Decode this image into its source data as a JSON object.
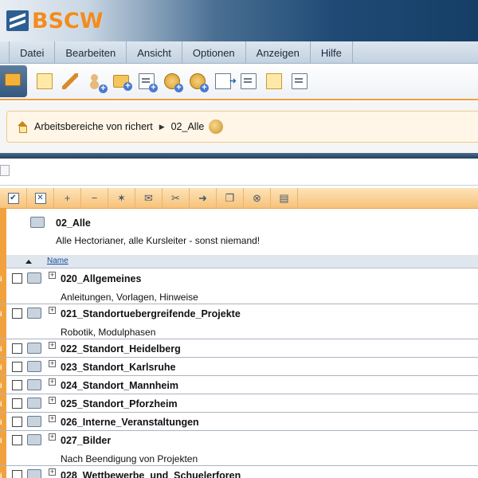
{
  "app": {
    "logo_text": "BSCW"
  },
  "menu": [
    "Datei",
    "Bearbeiten",
    "Ansicht",
    "Optionen",
    "Anzeigen",
    "Hilfe"
  ],
  "toolbar_icons": [
    "info-icon",
    "edit-icon",
    "add-member-icon",
    "new-folder-icon",
    "new-document-icon",
    "new-url-icon",
    "new-discussion-icon",
    "send-to-icon",
    "paste-icon",
    "mail-icon",
    "note-icon"
  ],
  "breadcrumb": {
    "items": [
      "Arbeitsbereiche von richert",
      "02_Alle"
    ]
  },
  "folder": {
    "title": "02_Alle",
    "description": "Alle Hectorianer, alle Kursleiter - sonst niemand!"
  },
  "table": {
    "column_name": "Name",
    "rows": [
      {
        "title": "020_Allgemeines",
        "description": "Anleitungen, Vorlagen, Hinweise"
      },
      {
        "title": "021_Standortuebergreifende_Projekte",
        "description": "Robotik, Modulphasen"
      },
      {
        "title": "022_Standort_Heidelberg",
        "description": ""
      },
      {
        "title": "023_Standort_Karlsruhe",
        "description": ""
      },
      {
        "title": "024_Standort_Mannheim",
        "description": ""
      },
      {
        "title": "025_Standort_Pforzheim",
        "description": ""
      },
      {
        "title": "026_Interne_Veranstaltungen",
        "description": ""
      },
      {
        "title": "027_Bilder",
        "description": "Nach Beendigung von Projekten"
      },
      {
        "title": "028_Wettbewerbe_und_Schuelerforen",
        "description": ""
      }
    ]
  },
  "colors": {
    "accent_orange": "#f2a23c",
    "header_blue": "#1f4a75",
    "logo_orange": "#f28c1e"
  }
}
